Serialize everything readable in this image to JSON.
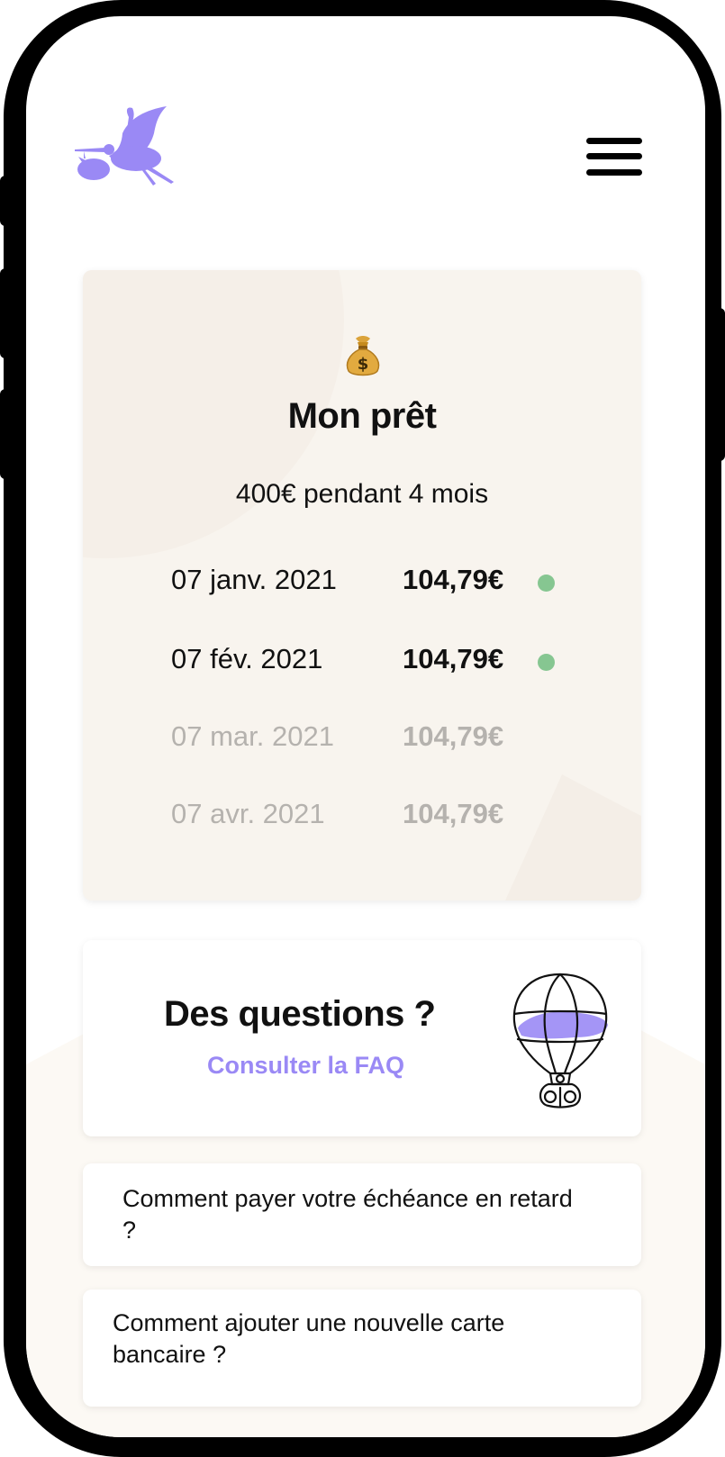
{
  "header": {
    "logo_icon": "stork-icon",
    "menu_icon": "hamburger-menu-icon"
  },
  "loan": {
    "icon": "money-bag-icon",
    "title": "Mon prêt",
    "summary": "400€ pendant 4 mois",
    "payments": [
      {
        "date": "07 janv. 2021",
        "amount": "104,79€",
        "status": "paid"
      },
      {
        "date": "07 fév. 2021",
        "amount": "104,79€",
        "status": "paid"
      },
      {
        "date": "07 mar. 2021",
        "amount": "104,79€",
        "status": "pending"
      },
      {
        "date": "07 avr. 2021",
        "amount": "104,79€",
        "status": "pending"
      }
    ]
  },
  "faq": {
    "title": "Des questions ?",
    "link_label": "Consulter la FAQ",
    "illustration": "hot-air-balloon-icon",
    "questions": [
      "Comment payer votre échéance en retard ?",
      "Comment ajouter une nouvelle carte bancaire ?"
    ]
  },
  "colors": {
    "brand": "#9a89f5",
    "paid": "#86c691",
    "card_bg": "#f8f4ee",
    "pending_text": "#b5b2ae"
  }
}
